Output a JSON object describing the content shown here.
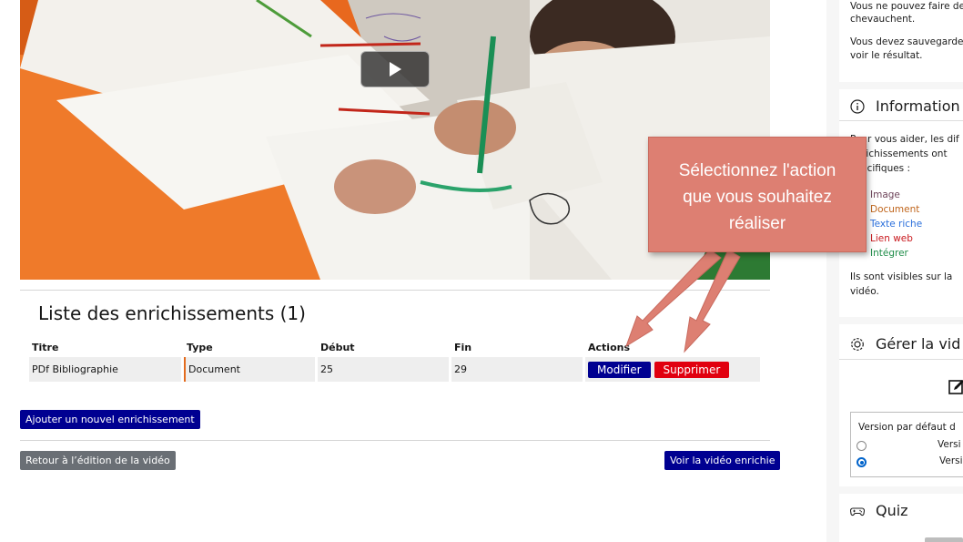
{
  "enrichments": {
    "title": "Liste des enrichissements (1)",
    "columns": [
      "Titre",
      "Type",
      "Début",
      "Fin",
      "Actions"
    ],
    "rows": [
      {
        "title": "PDf Bibliographie",
        "type": "Document",
        "start": "25",
        "end": "29",
        "edit_label": "Modifier",
        "delete_label": "Supprimer"
      }
    ]
  },
  "buttons": {
    "add": "Ajouter un nouvel enrichissement",
    "back": "Retour à l’édition de la vidéo",
    "view": "Voir la vidéo enrichie"
  },
  "sidebar": {
    "warning_line1": "Vous ne pouvez faire des",
    "warning_line2": "chevauchent.",
    "save_line1": "Vous devez sauvegarder v",
    "save_line2": "voir le résultat.",
    "info_title": "Information",
    "info_line1": "Pour vous aider, les dif",
    "info_line2": "enrichissements ont",
    "info_line3": "spécifiques :",
    "types": [
      {
        "label": "Image",
        "color": "#6e445a"
      },
      {
        "label": "Document",
        "color": "#c0661d"
      },
      {
        "label": "Texte riche",
        "color": "#2a6fdb"
      },
      {
        "label": "Lien web",
        "color": "#c9191e"
      },
      {
        "label": "Intégrer",
        "color": "#1f8d49"
      }
    ],
    "visible_line1": "Ils sont visibles sur la",
    "visible_line2": "vidéo.",
    "manage_title": "Gérer la vid",
    "version_label": "Version par défaut d",
    "version_opt1": "Versi",
    "version_opt2": "Versi",
    "quiz_title": "Quiz"
  },
  "callout": {
    "text": "Sélectionnez l'action\nque vous souhaitez\nréaliser"
  },
  "colors": {
    "primary_blue": "#000091",
    "danger_red": "#e1000f",
    "grey_button": "#6a6f75",
    "callout": "#dd7f72",
    "document_accent": "#e36b1d"
  }
}
